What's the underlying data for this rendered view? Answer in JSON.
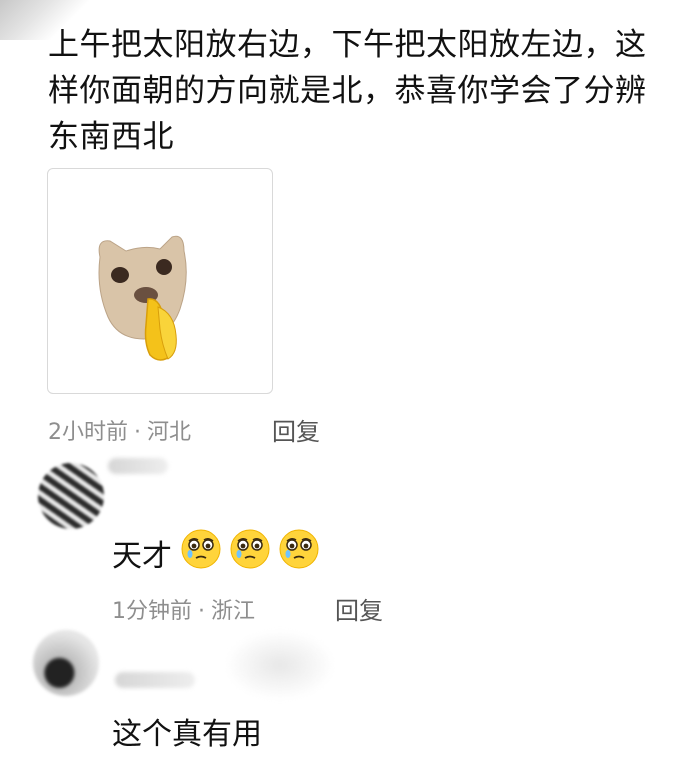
{
  "main_comment": {
    "text": "上午把太阳放右边，下午把太阳放左边，这样你面朝的方向就是北，恭喜你学会了分辨东南西北",
    "sticker": "cat-sticker-icon",
    "time": "2小时前",
    "separator": "·",
    "location": "河北",
    "reply_label": "回复"
  },
  "replies": [
    {
      "avatar": "avatar",
      "text": "天才",
      "emojis": [
        "crying-face-icon",
        "crying-face-icon",
        "crying-face-icon"
      ],
      "time": "1分钟前",
      "separator": "·",
      "location": "浙江",
      "reply_label": "回复"
    },
    {
      "avatar": "avatar",
      "text": "这个真有用"
    }
  ]
}
